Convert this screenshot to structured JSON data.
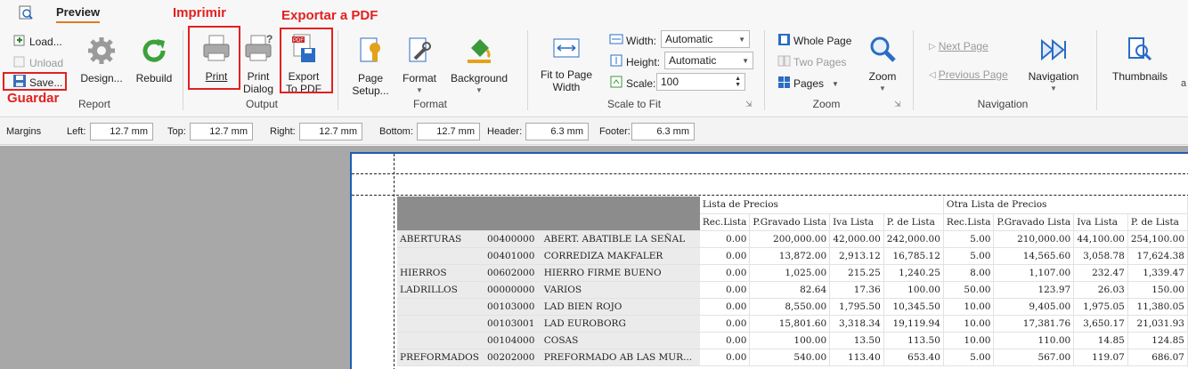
{
  "ribbon_tab": "Preview",
  "annotations": {
    "guardar": "Guardar",
    "imprimir": "Imprimir",
    "exportar": "Exportar a PDF"
  },
  "report_group": {
    "load": "Load...",
    "unload": "Unload",
    "save": "Save...",
    "design": "Design...",
    "rebuild": "Rebuild",
    "label": "Report"
  },
  "output_group": {
    "print": "Print",
    "print_dialog_1": "Print",
    "print_dialog_2": "Dialog",
    "export_1": "Export",
    "export_2": "To PDF",
    "label": "Output"
  },
  "format_group": {
    "page_setup_1": "Page",
    "page_setup_2": "Setup...",
    "format": "Format",
    "background": "Background",
    "label": "Format"
  },
  "scale_group": {
    "fit_1": "Fit to Page",
    "fit_2": "Width",
    "width_label": "Width:",
    "width_value": "Automatic",
    "height_label": "Height:",
    "height_value": "Automatic",
    "scale_label": "Scale:",
    "scale_value": "100",
    "label": "Scale to Fit"
  },
  "zoom_group": {
    "whole_page": "Whole Page",
    "two_pages": "Two Pages",
    "pages": "Pages",
    "zoom": "Zoom",
    "label": "Zoom"
  },
  "navigation_group": {
    "next_page": "Next Page",
    "previous_page": "Previous Page",
    "navigation": "Navigation",
    "thumbnails": "Thumbnails",
    "label": "Navigation"
  },
  "margins": {
    "title": "Margins",
    "left_label": "Left:",
    "left": "12.7 mm",
    "top_label": "Top:",
    "top": "12.7 mm",
    "right_label": "Right:",
    "right": "12.7 mm",
    "bottom_label": "Bottom:",
    "bottom": "12.7 mm",
    "header_label": "Header:",
    "header": "6.3 mm",
    "footer_label": "Footer:",
    "footer": "6.3 mm"
  },
  "report": {
    "group1": "Lista de Precios",
    "group2": "Otra Lista de Precios",
    "columns": [
      "Rec.Lista",
      "P.Gravado Lista",
      "Iva Lista",
      "P. de Lista",
      "Rec.Lista",
      "P.Gravado Lista",
      "Iva Lista",
      "P. de Lista"
    ],
    "rows": [
      {
        "cat": "ABERTURAS",
        "code": "00400000",
        "desc": "ABERT. ABATIBLE LA SEÑAL",
        "v": [
          "0.00",
          "200,000.00",
          "42,000.00",
          "242,000.00",
          "5.00",
          "210,000.00",
          "44,100.00",
          "254,100.00"
        ]
      },
      {
        "cat": "",
        "code": "00401000",
        "desc": "CORREDIZA MAKFALER",
        "v": [
          "0.00",
          "13,872.00",
          "2,913.12",
          "16,785.12",
          "5.00",
          "14,565.60",
          "3,058.78",
          "17,624.38"
        ]
      },
      {
        "cat": "HIERROS",
        "code": "00602000",
        "desc": "HIERRO FIRME BUENO",
        "v": [
          "0.00",
          "1,025.00",
          "215.25",
          "1,240.25",
          "8.00",
          "1,107.00",
          "232.47",
          "1,339.47"
        ]
      },
      {
        "cat": "LADRILLOS",
        "code": "00000000",
        "desc": "VARIOS",
        "v": [
          "0.00",
          "82.64",
          "17.36",
          "100.00",
          "50.00",
          "123.97",
          "26.03",
          "150.00"
        ]
      },
      {
        "cat": "",
        "code": "00103000",
        "desc": "LAD BIEN ROJO",
        "v": [
          "0.00",
          "8,550.00",
          "1,795.50",
          "10,345.50",
          "10.00",
          "9,405.00",
          "1,975.05",
          "11,380.05"
        ]
      },
      {
        "cat": "",
        "code": "00103001",
        "desc": "LAD EUROBORG",
        "v": [
          "0.00",
          "15,801.60",
          "3,318.34",
          "19,119.94",
          "10.00",
          "17,381.76",
          "3,650.17",
          "21,031.93"
        ]
      },
      {
        "cat": "",
        "code": "00104000",
        "desc": "COSAS",
        "v": [
          "0.00",
          "100.00",
          "13.50",
          "113.50",
          "10.00",
          "110.00",
          "14.85",
          "124.85"
        ]
      },
      {
        "cat": "PREFORMADOS",
        "code": "00202000",
        "desc": "PREFORMADO AB LAS MUR...",
        "v": [
          "0.00",
          "540.00",
          "113.40",
          "653.40",
          "5.00",
          "567.00",
          "119.07",
          "686.07"
        ]
      }
    ]
  }
}
